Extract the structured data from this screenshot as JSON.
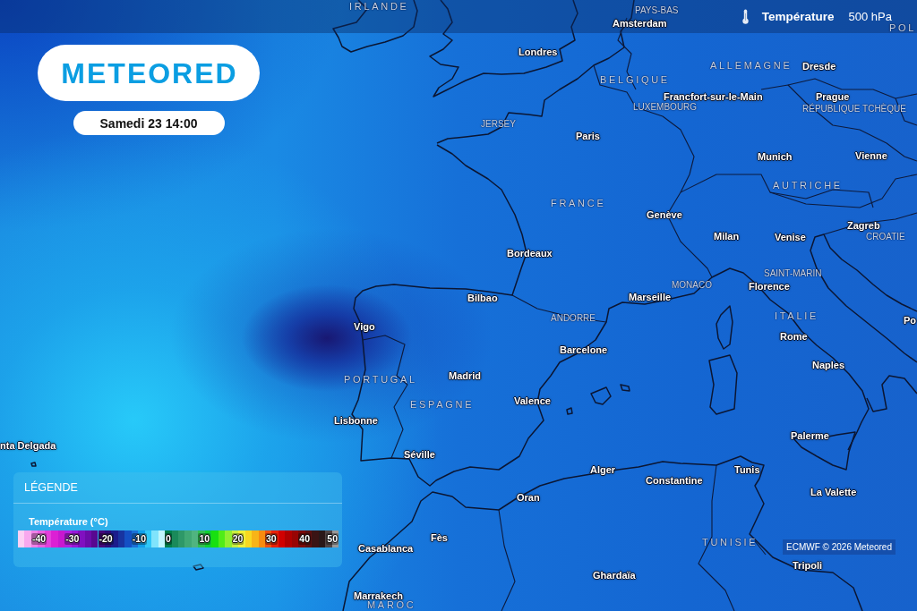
{
  "top_bar": {
    "variable": "Température",
    "pressure_level": "500 hPa"
  },
  "brand": {
    "logo": "METEORED",
    "date": "Samedi 23 14:00"
  },
  "map": {
    "labels": [
      {
        "text": "IRLANDE",
        "kind": "country"
      },
      {
        "text": "PAYS-BAS",
        "kind": "minor"
      },
      {
        "text": "Amsterdam",
        "kind": "city"
      },
      {
        "text": "POL",
        "kind": "country"
      },
      {
        "text": "Londres",
        "kind": "city"
      },
      {
        "text": "ALLEMAGNE",
        "kind": "country"
      },
      {
        "text": "Dresde",
        "kind": "city"
      },
      {
        "text": "BELGIQUE",
        "kind": "country"
      },
      {
        "text": "Francfort-sur-le-Main",
        "kind": "city"
      },
      {
        "text": "Prague",
        "kind": "city"
      },
      {
        "text": "LUXEMBOURG",
        "kind": "minor"
      },
      {
        "text": "RÉPUBLIQUE TCHÈQUE",
        "kind": "minor"
      },
      {
        "text": "JERSEY",
        "kind": "minor"
      },
      {
        "text": "Paris",
        "kind": "city"
      },
      {
        "text": "Vienne",
        "kind": "city"
      },
      {
        "text": "Munich",
        "kind": "city"
      },
      {
        "text": "AUTRICHE",
        "kind": "country"
      },
      {
        "text": "FRANCE",
        "kind": "country"
      },
      {
        "text": "Genève",
        "kind": "city"
      },
      {
        "text": "Zagreb",
        "kind": "city"
      },
      {
        "text": "Milan",
        "kind": "city"
      },
      {
        "text": "Venise",
        "kind": "city"
      },
      {
        "text": "CROATIE",
        "kind": "minor"
      },
      {
        "text": "Bordeaux",
        "kind": "city"
      },
      {
        "text": "SAINT-MARIN",
        "kind": "minor"
      },
      {
        "text": "Florence",
        "kind": "city"
      },
      {
        "text": "MONACO",
        "kind": "minor"
      },
      {
        "text": "Bilbao",
        "kind": "city"
      },
      {
        "text": "Marseille",
        "kind": "city"
      },
      {
        "text": "ANDORRE",
        "kind": "minor"
      },
      {
        "text": "ITALIE",
        "kind": "country"
      },
      {
        "text": "Po",
        "kind": "city"
      },
      {
        "text": "Vigo",
        "kind": "city"
      },
      {
        "text": "Rome",
        "kind": "city"
      },
      {
        "text": "Barcelone",
        "kind": "city"
      },
      {
        "text": "Naples",
        "kind": "city"
      },
      {
        "text": "Madrid",
        "kind": "city"
      },
      {
        "text": "PORTUGAL",
        "kind": "country"
      },
      {
        "text": "Valence",
        "kind": "city"
      },
      {
        "text": "ESPAGNE",
        "kind": "country"
      },
      {
        "text": "Lisbonne",
        "kind": "city"
      },
      {
        "text": "Palerme",
        "kind": "city"
      },
      {
        "text": "nta Delgada",
        "kind": "city"
      },
      {
        "text": "Séville",
        "kind": "city"
      },
      {
        "text": "Alger",
        "kind": "city"
      },
      {
        "text": "Tunis",
        "kind": "city"
      },
      {
        "text": "Constantine",
        "kind": "city"
      },
      {
        "text": "La Valette",
        "kind": "city"
      },
      {
        "text": "Oran",
        "kind": "city"
      },
      {
        "text": "Fès",
        "kind": "city"
      },
      {
        "text": "TUNISIE",
        "kind": "country"
      },
      {
        "text": "Casablanca",
        "kind": "city"
      },
      {
        "text": "Tripoli",
        "kind": "city"
      },
      {
        "text": "Ghardaïa",
        "kind": "city"
      },
      {
        "text": "Marrakech",
        "kind": "city"
      },
      {
        "text": "MAROC",
        "kind": "country"
      }
    ]
  },
  "legend": {
    "title": "LÉGENDE",
    "variable": "Température (°C)",
    "scale": [
      {
        "swatches": [
          {
            "color": "#fcd0f4"
          },
          {
            "color": "#f8a8ee"
          }
        ]
      },
      {
        "label": "-40",
        "swatches": [
          {
            "color": "#f080e8"
          },
          {
            "color": "#ea60e2"
          },
          {
            "color": "#e440dc"
          },
          {
            "color": "#dc20d4"
          },
          {
            "color": "#c818d0"
          }
        ]
      },
      {
        "label": "-30",
        "swatches": [
          {
            "color": "#b020e0"
          },
          {
            "color": "#9818d8"
          },
          {
            "color": "#8010c0"
          },
          {
            "color": "#6c0caa"
          },
          {
            "color": "#580890"
          }
        ]
      },
      {
        "label": "-20",
        "swatches": [
          {
            "color": "#44087a"
          },
          {
            "color": "#2c0c78"
          },
          {
            "color": "#1c1c8c"
          },
          {
            "color": "#1834a0"
          },
          {
            "color": "#1450c4"
          }
        ]
      },
      {
        "label": "-10",
        "swatches": [
          {
            "color": "#1a70d8"
          },
          {
            "color": "#10a0ec"
          },
          {
            "color": "#30c8f8"
          },
          {
            "color": "#80e4fc"
          },
          {
            "color": "#c0f6fc"
          }
        ]
      },
      {
        "label": "0",
        "swatches": [
          {
            "color": "#00804a"
          },
          {
            "color": "#1a8a5a"
          },
          {
            "color": "#2e9868"
          },
          {
            "color": "#40a874"
          },
          {
            "color": "#50b480"
          }
        ]
      },
      {
        "label": "10",
        "swatches": [
          {
            "color": "#30c050"
          },
          {
            "color": "#10d030"
          },
          {
            "color": "#18e010"
          },
          {
            "color": "#50ec18"
          },
          {
            "color": "#90f030"
          }
        ]
      },
      {
        "label": "20",
        "swatches": [
          {
            "color": "#c8f040"
          },
          {
            "color": "#f0f038"
          },
          {
            "color": "#f8d820"
          },
          {
            "color": "#f8b418"
          },
          {
            "color": "#f88c10"
          }
        ]
      },
      {
        "label": "30",
        "swatches": [
          {
            "color": "#f05010"
          },
          {
            "color": "#e82008"
          },
          {
            "color": "#d00000"
          },
          {
            "color": "#b00000"
          },
          {
            "color": "#980404"
          }
        ]
      },
      {
        "label": "40",
        "swatches": [
          {
            "color": "#7a0a0a"
          },
          {
            "color": "#5a1010"
          },
          {
            "color": "#3a1414"
          },
          {
            "color": "#2a1818"
          },
          {
            "color": "#504444"
          }
        ]
      },
      {
        "label": "50",
        "swatches": [
          {
            "color": "#989898"
          }
        ]
      }
    ]
  },
  "credit": "ECMWF © 2026 Meteored"
}
